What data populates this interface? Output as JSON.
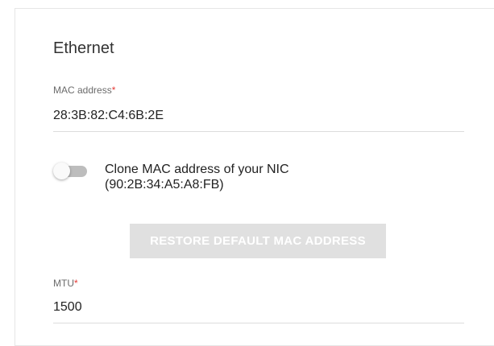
{
  "section": {
    "title": "Ethernet"
  },
  "mac_field": {
    "label": "MAC address",
    "required_mark": "*",
    "value": "28:3B:82:C4:6B:2E"
  },
  "clone_toggle": {
    "label_line1": "Clone MAC address of your NIC",
    "label_line2": "(90:2B:34:A5:A8:FB)",
    "checked": false
  },
  "restore_button": {
    "label": "RESTORE DEFAULT MAC ADDRESS",
    "disabled": true
  },
  "mtu_field": {
    "label": "MTU",
    "required_mark": "*",
    "value": "1500"
  },
  "colors": {
    "required": "#e53935",
    "disabled_button": "#e0e0e0",
    "toggle_track_off": "#bdbdbd"
  }
}
